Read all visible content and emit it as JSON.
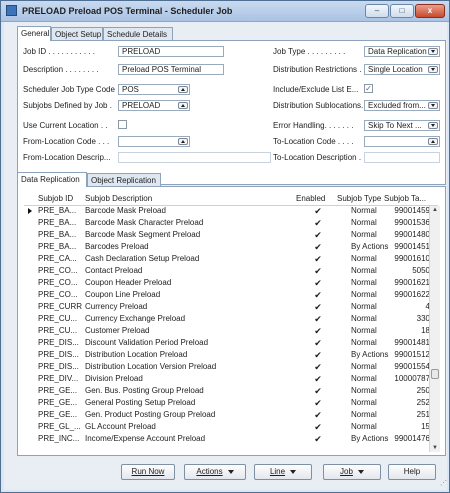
{
  "window": {
    "title": "PRELOAD Preload POS Terminal - Scheduler Job",
    "min": "–",
    "max": "□",
    "close": "x"
  },
  "tabs": [
    "General",
    "Object Setup",
    "Schedule Details"
  ],
  "general": {
    "job_id_label": "Job ID . . . . . . . . . . .",
    "job_id": "PRELOAD",
    "description_label": "Description . . . . . . . .",
    "description": "Preload POS Terminal",
    "scheduler_job_type_label": "Scheduler Job Type Code",
    "scheduler_job_type": "POS",
    "subjobs_defined_by_label": "Subjobs Defined by Job .",
    "subjobs_defined_by": "PRELOAD",
    "use_current_location_label": "Use Current Location . .",
    "from_location_code_label": "From-Location Code . . .",
    "from_location_code": "",
    "from_location_desc_label": "From-Location Descrip...",
    "from_location_desc": "",
    "job_type_label": "Job Type . . . . . . . . .",
    "job_type": "Data Replication",
    "dist_restrictions_label": "Distribution Restrictions .",
    "dist_restrictions": "Single Location",
    "include_exclude_label": "Include/Exclude List E...",
    "include_exclude_checked": true,
    "dist_sublocations_label": "Distribution Sublocations.",
    "dist_sublocations": "Excluded from...",
    "error_handling_label": "Error Handling. . . . . . .",
    "error_handling": "Skip To Next ...",
    "to_location_code_label": "To-Location Code . . . .",
    "to_location_code": "",
    "to_location_desc_label": "To-Location Description .",
    "to_location_desc": ""
  },
  "subtabs": [
    "Data Replication",
    "Object Replication"
  ],
  "grid": {
    "headers": {
      "id": "Subjob ID",
      "desc": "Subjob Description",
      "enabled": "Enabled",
      "type": "Subjob Type",
      "table": "Subjob Ta..."
    },
    "rows": [
      {
        "id": "PRE_BA...",
        "desc": "Barcode Mask Preload",
        "enabled": "✔",
        "type": "Normal",
        "table": "99001459"
      },
      {
        "id": "PRE_BA...",
        "desc": "Barcode Mask Character Preload",
        "enabled": "✔",
        "type": "Normal",
        "table": "99001536"
      },
      {
        "id": "PRE_BA...",
        "desc": "Barcode Mask Segment Preload",
        "enabled": "✔",
        "type": "Normal",
        "table": "99001480"
      },
      {
        "id": "PRE_BA...",
        "desc": "Barcodes Preload",
        "enabled": "✔",
        "type": "By Actions",
        "table": "99001451"
      },
      {
        "id": "PRE_CA...",
        "desc": "Cash Declaration Setup Preload",
        "enabled": "✔",
        "type": "Normal",
        "table": "99001610"
      },
      {
        "id": "PRE_CO...",
        "desc": "Contact Preload",
        "enabled": "✔",
        "type": "Normal",
        "table": "5050"
      },
      {
        "id": "PRE_CO...",
        "desc": "Coupon Header Preload",
        "enabled": "✔",
        "type": "Normal",
        "table": "99001621"
      },
      {
        "id": "PRE_CO...",
        "desc": "Coupon Line Preload",
        "enabled": "✔",
        "type": "Normal",
        "table": "99001622"
      },
      {
        "id": "PRE_CURR",
        "desc": "Currency Preload",
        "enabled": "✔",
        "type": "Normal",
        "table": "4"
      },
      {
        "id": "PRE_CU...",
        "desc": "Currency Exchange Preload",
        "enabled": "✔",
        "type": "Normal",
        "table": "330"
      },
      {
        "id": "PRE_CU...",
        "desc": "Customer Preload",
        "enabled": "✔",
        "type": "Normal",
        "table": "18"
      },
      {
        "id": "PRE_DIS...",
        "desc": "Discount Validation Period Preload",
        "enabled": "✔",
        "type": "Normal",
        "table": "99001481"
      },
      {
        "id": "PRE_DIS...",
        "desc": "Distribution Location Preload",
        "enabled": "✔",
        "type": "By Actions",
        "table": "99001512"
      },
      {
        "id": "PRE_DIS...",
        "desc": "Distribution Location Version Preload",
        "enabled": "✔",
        "type": "Normal",
        "table": "99001554"
      },
      {
        "id": "PRE_DIV...",
        "desc": "Division Preload",
        "enabled": "✔",
        "type": "Normal",
        "table": "10000787"
      },
      {
        "id": "PRE_GE...",
        "desc": "Gen. Bus. Posting Group Preload",
        "enabled": "✔",
        "type": "Normal",
        "table": "250"
      },
      {
        "id": "PRE_GE...",
        "desc": "General Posting Setup Preload",
        "enabled": "✔",
        "type": "Normal",
        "table": "252"
      },
      {
        "id": "PRE_GE...",
        "desc": "Gen. Product Posting Group Preload",
        "enabled": "✔",
        "type": "Normal",
        "table": "251"
      },
      {
        "id": "PRE_GL_...",
        "desc": "GL Account Preload",
        "enabled": "✔",
        "type": "Normal",
        "table": "15"
      },
      {
        "id": "PRE_INC...",
        "desc": "Income/Expense Account Preload",
        "enabled": "✔",
        "type": "By Actions",
        "table": "99001476"
      }
    ]
  },
  "buttons": {
    "run_now": "Run Now",
    "actions": "Actions",
    "line": "Line",
    "job": "Job",
    "help": "Help"
  }
}
